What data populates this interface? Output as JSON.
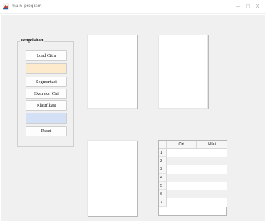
{
  "window": {
    "title": "main_program",
    "minimize_glyph": "—",
    "maximize_glyph": "□",
    "close_glyph": "X"
  },
  "panel": {
    "title": "Pengolahan",
    "buttons": {
      "load": "Load Citra",
      "segmentasi": "Segmentasi",
      "ekstraksi": "Ekstraksi Ciri",
      "klasifikasi": "Klasifikasi",
      "reset": "Reset"
    },
    "field_top": {
      "value": "",
      "bg_color": "#fde9cc"
    },
    "field_bottom": {
      "value": "",
      "bg_color": "#d4e0f6"
    }
  },
  "table": {
    "columns": [
      "Ciri",
      "Nilai"
    ],
    "row_numbers": [
      "1",
      "2",
      "3",
      "4",
      "5",
      "6",
      "7"
    ],
    "rows": [
      [
        "",
        ""
      ],
      [
        "",
        ""
      ],
      [
        "",
        ""
      ],
      [
        "",
        ""
      ],
      [
        "",
        ""
      ],
      [
        "",
        ""
      ],
      [
        "",
        ""
      ]
    ],
    "stripe_color": "#f0f0f0"
  },
  "colors": {
    "matlab_icon_top": "#d9432b",
    "matlab_icon_bottom": "#1f5fa8"
  }
}
